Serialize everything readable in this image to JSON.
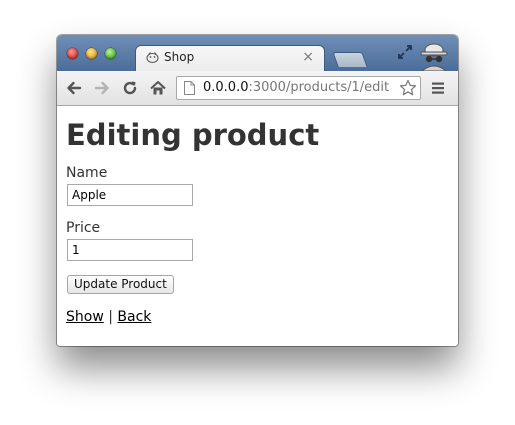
{
  "browser": {
    "tab_title": "Shop",
    "tab_close_glyph": "×",
    "url_host": "0.0.0.0",
    "url_rest": ":3000/products/1/edit",
    "icons": [
      "favicon-icon",
      "fullscreen-icon",
      "incognito-icon",
      "back-icon",
      "forward-icon",
      "reload-icon",
      "home-icon",
      "page-icon",
      "star-icon",
      "menu-icon"
    ]
  },
  "page": {
    "title": "Editing product",
    "name_label": "Name",
    "name_value": "Apple",
    "price_label": "Price",
    "price_value": "1",
    "submit_label": "Update Product",
    "show_link": "Show",
    "separator": "|",
    "back_link": "Back"
  }
}
